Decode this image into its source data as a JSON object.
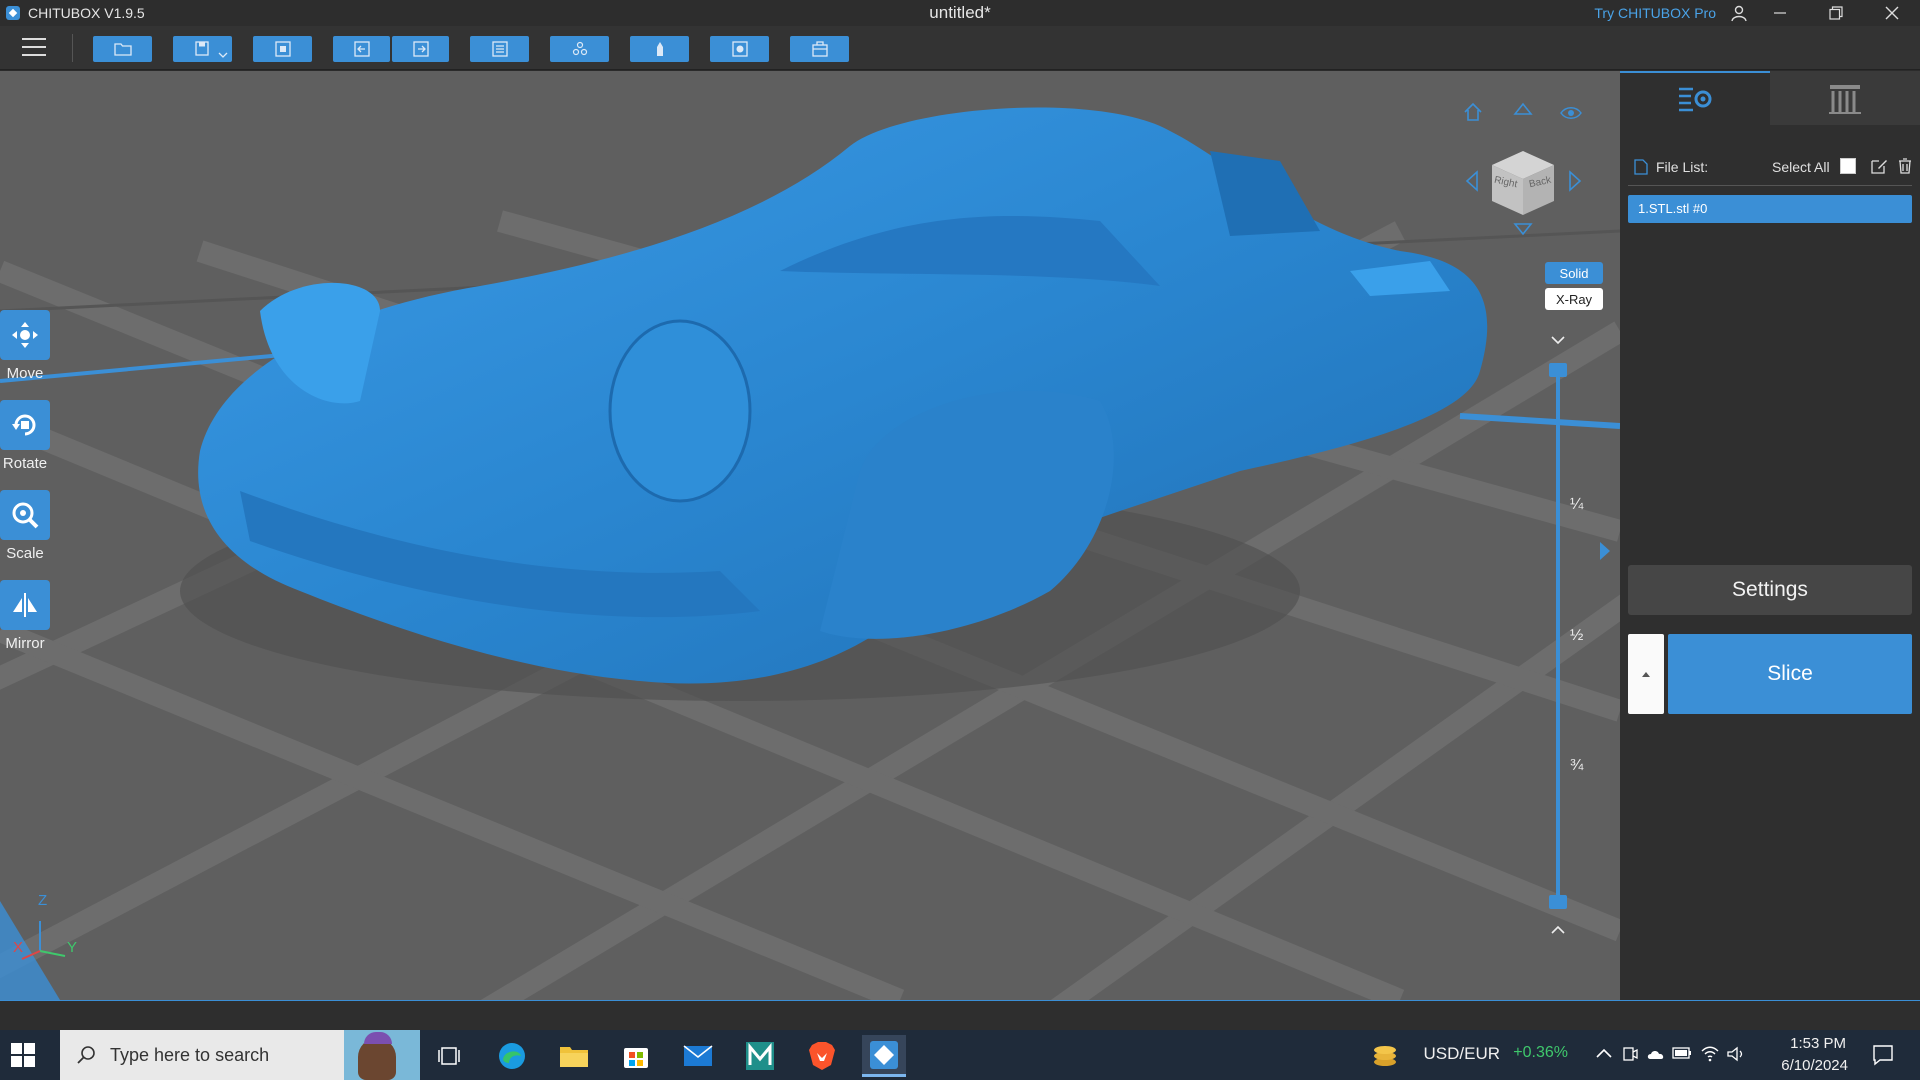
{
  "titlebar": {
    "app_name": "CHITUBOX V1.9.5",
    "doc_title": "untitled*",
    "try_pro": "Try CHITUBOX Pro"
  },
  "toolbar": {
    "buttons": [
      "open-file-icon",
      "save-icon",
      "export-icon",
      "undo-icon",
      "redo-icon",
      "layout-icon",
      "arrange-icon",
      "hollow-icon",
      "drain-hole-icon",
      "support-icon"
    ]
  },
  "left_tools": {
    "move": "Move",
    "rotate": "Rotate",
    "scale": "Scale",
    "mirror": "Mirror"
  },
  "view": {
    "cube_right": "Right",
    "cube_back": "Back",
    "solid": "Solid",
    "xray": "X-Ray",
    "active_mode": "Solid"
  },
  "slider": {
    "quarter": "¼",
    "half": "½",
    "three_quarter": "¾"
  },
  "axes": {
    "x": "X",
    "y": "Y",
    "z": "Z"
  },
  "right_panel": {
    "file_list_label": "File List:",
    "select_all": "Select All",
    "file_item": "1.STL.stl #0",
    "settings": "Settings",
    "slice": "Slice"
  },
  "taskbar": {
    "search_placeholder": "Type here to search",
    "ticker": "USD/EUR",
    "ticker_change": "+0.36%",
    "time": "1:53 PM",
    "date": "6/10/2024"
  },
  "colors": {
    "accent": "#3b8fd6",
    "model": "#2f8fd9",
    "positive": "#3fc86c"
  }
}
